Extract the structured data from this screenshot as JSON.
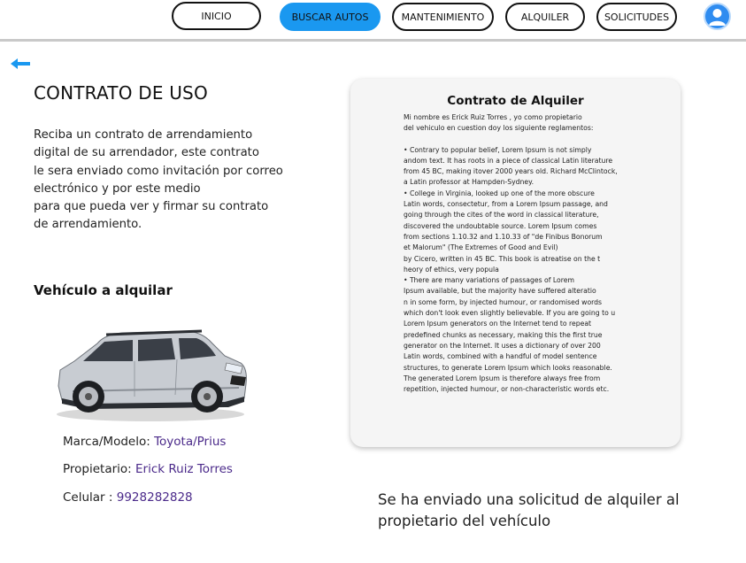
{
  "nav": {
    "items": [
      {
        "label": "INICIO",
        "active": false
      },
      {
        "label": "BUSCAR AUTOS",
        "active": true
      },
      {
        "label": "MANTENIMIENTO",
        "active": false
      },
      {
        "label": "ALQUILER",
        "active": false
      },
      {
        "label": "SOLICITUDES",
        "active": false
      }
    ],
    "avatar_icon": "user-icon"
  },
  "back_icon": "arrow-left-icon",
  "page": {
    "title": "CONTRATO DE USO",
    "intro_lines": [
      "Reciba un contrato de arrendamiento",
      "digital de su arrendador, este contrato",
      "le sera enviado como invitación por correo",
      "electrónico y por este medio",
      "para que pueda ver y firmar su contrato",
      "de arrendamiento."
    ]
  },
  "vehicle": {
    "title": "Vehículo a alquilar",
    "image_icon": "car-image",
    "brand_label": "Marca/Modelo: ",
    "brand_value": "Toyota/Prius",
    "owner_label": "Propietario: ",
    "owner_value": "Erick Ruiz Torres",
    "phone_label": "Celular : ",
    "phone_value": "9928282828"
  },
  "contract": {
    "title": "Contrato de Alquiler",
    "intro_lines": [
      "Mi nombre es Erick Ruiz Torres , yo como propietario",
      "del vehiculo en cuestion doy los siguiente  reglamentos:"
    ],
    "body_lines": [
      " •  Contrary to popular belief, Lorem Ipsum is not simply",
      "andom text. It has roots in a piece of classical Latin literature",
      " from 45 BC, making itover 2000 years old. Richard McClintock,",
      "a Latin professor at Hampden-Sydney.",
      " •  College in Virginia, looked up one of the more obscure",
      " Latin words, consectetur, from a Lorem Ipsum passage, and",
      "going through the cites of the word in classical literature,",
      "discovered the undoubtable source. Lorem Ipsum comes",
      " from sections 1.10.32 and 1.10.33 of \"de Finibus Bonorum",
      " et Malorum\" (The Extremes of Good and Evil)",
      " by Cicero, written in 45 BC. This book is atreatise on the t",
      "heory of ethics, very popula",
      " •  There are many variations of passages of Lorem",
      " Ipsum available, but the majority have suffered alteratio",
      "n in some form, by injected humour, or randomised words",
      "which don't look even slightly believable. If you are going to u",
      "Lorem Ipsum generators on the Internet tend to repeat",
      "predefined chunks as necessary, making this the first true",
      " generator on the Internet. It uses a dictionary of over 200",
      "Latin words, combined with a handful of model sentence",
      "structures, to generate Lorem Ipsum which looks reasonable.",
      " The generated Lorem Ipsum is therefore always free from",
      " repetition, injected humour, or non-characteristic words etc."
    ]
  },
  "confirmation": {
    "lines": [
      "Se ha enviado una solicitud de alquiler al",
      "propietario del vehículo"
    ]
  }
}
